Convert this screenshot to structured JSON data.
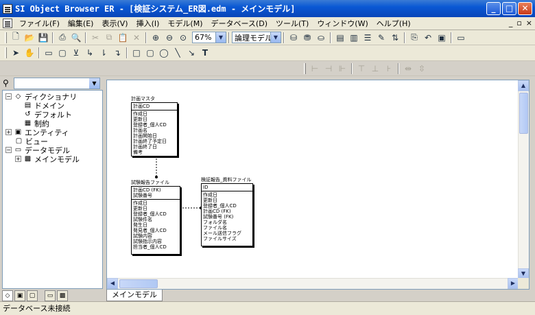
{
  "window": {
    "title": "SI Object Browser ER - [検証システム_ER図.edm - メインモデル]",
    "minimize": "_",
    "maximize": "□",
    "close": "✕"
  },
  "menubar": {
    "items": [
      "ファイル(F)",
      "編集(E)",
      "表示(V)",
      "挿入(I)",
      "モデル(M)",
      "データベース(D)",
      "ツール(T)",
      "ウィンドウ(W)",
      "ヘルプ(H)"
    ],
    "mdi_min": "_",
    "mdi_restore": "▫",
    "mdi_close": "×"
  },
  "toolbar": {
    "zoom_value": "67%",
    "model_value": "論理モデル"
  },
  "left_panel": {
    "tree": [
      {
        "label": "ディクショナリ",
        "icon": "book-icon",
        "toggle": "−"
      },
      {
        "label": "ドメイン",
        "icon": "domain-icon",
        "toggle": ""
      },
      {
        "label": "デフォルト",
        "icon": "default-icon",
        "toggle": ""
      },
      {
        "label": "制約",
        "icon": "constraint-icon",
        "toggle": ""
      },
      {
        "label": "エンティティ",
        "icon": "entity-icon",
        "toggle": "+"
      },
      {
        "label": "ビュー",
        "icon": "view-icon",
        "toggle": ""
      },
      {
        "label": "データモデル",
        "icon": "model-icon",
        "toggle": "−"
      },
      {
        "label": "メインモデル",
        "icon": "diagram-icon",
        "toggle": "+"
      }
    ]
  },
  "diagram": {
    "entities": [
      {
        "name": "計画マスタ",
        "pk": [
          "計画CD"
        ],
        "attrs": [
          "作成日",
          "更新日",
          "登録者_個人CD",
          "計画名",
          "計画開始日",
          "計画終了予定日",
          "計画終了日",
          "備考"
        ]
      },
      {
        "name": "試験報告ファイル",
        "pk": [
          "計画CD (FK)",
          "試験番号"
        ],
        "attrs": [
          "作成日",
          "更新日",
          "登録者_個人CD",
          "試験件名",
          "発生日",
          "発見者_個人CD",
          "試験内容",
          "試験指示内容",
          "担当者_個人CD"
        ]
      },
      {
        "name": "検証報告_資料ファイル",
        "pk": [
          "ID"
        ],
        "attrs": [
          "作成日",
          "更新日",
          "登録者_個人CD",
          "計画CD (FK)",
          "試験番号 (FK)",
          "フォルダ名",
          "ファイル名",
          "メール送信フラグ",
          "ファイルサイズ"
        ]
      }
    ]
  },
  "doc_tab": "メインモデル",
  "status": "データベース未接続"
}
